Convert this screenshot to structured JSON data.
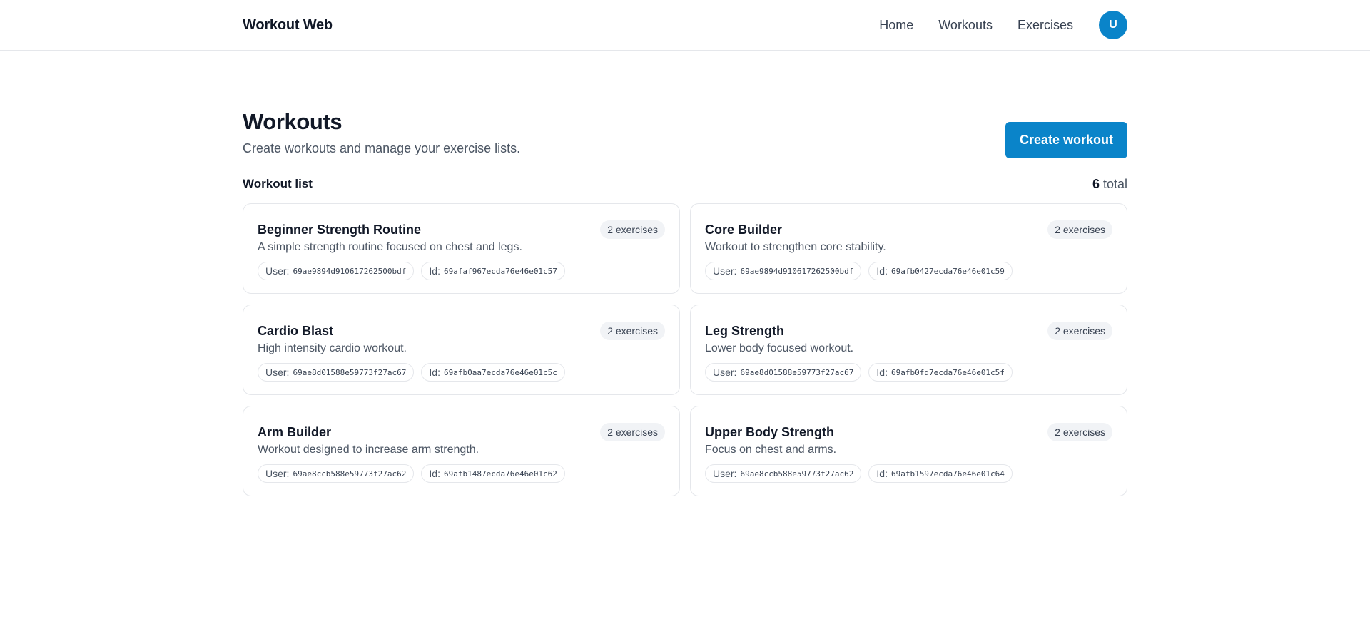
{
  "header": {
    "brand": "Workout Web",
    "nav": [
      {
        "label": "Home"
      },
      {
        "label": "Workouts"
      },
      {
        "label": "Exercises"
      }
    ],
    "avatar_initial": "U",
    "accent": "#0a84c9"
  },
  "page": {
    "title": "Workouts",
    "subtitle": "Create workouts and manage your exercise lists.",
    "create_label": "Create workout"
  },
  "list": {
    "title": "Workout list",
    "count": "6",
    "total_label": "total",
    "user_label": "User:",
    "id_label": "Id:"
  },
  "workouts": [
    {
      "name": "Beginner Strength Routine",
      "badge": "2 exercises",
      "description": "A simple strength routine focused on chest and legs.",
      "user": "69ae9894d910617262500bdf",
      "id": "69afaf967ecda76e46e01c57"
    },
    {
      "name": "Core Builder",
      "badge": "2 exercises",
      "description": "Workout to strengthen core stability.",
      "user": "69ae9894d910617262500bdf",
      "id": "69afb0427ecda76e46e01c59"
    },
    {
      "name": "Cardio Blast",
      "badge": "2 exercises",
      "description": "High intensity cardio workout.",
      "user": "69ae8d01588e59773f27ac67",
      "id": "69afb0aa7ecda76e46e01c5c"
    },
    {
      "name": "Leg Strength",
      "badge": "2 exercises",
      "description": "Lower body focused workout.",
      "user": "69ae8d01588e59773f27ac67",
      "id": "69afb0fd7ecda76e46e01c5f"
    },
    {
      "name": "Arm Builder",
      "badge": "2 exercises",
      "description": "Workout designed to increase arm strength.",
      "user": "69ae8ccb588e59773f27ac62",
      "id": "69afb1487ecda76e46e01c62"
    },
    {
      "name": "Upper Body Strength",
      "badge": "2 exercises",
      "description": "Focus on chest and arms.",
      "user": "69ae8ccb588e59773f27ac62",
      "id": "69afb1597ecda76e46e01c64"
    }
  ]
}
